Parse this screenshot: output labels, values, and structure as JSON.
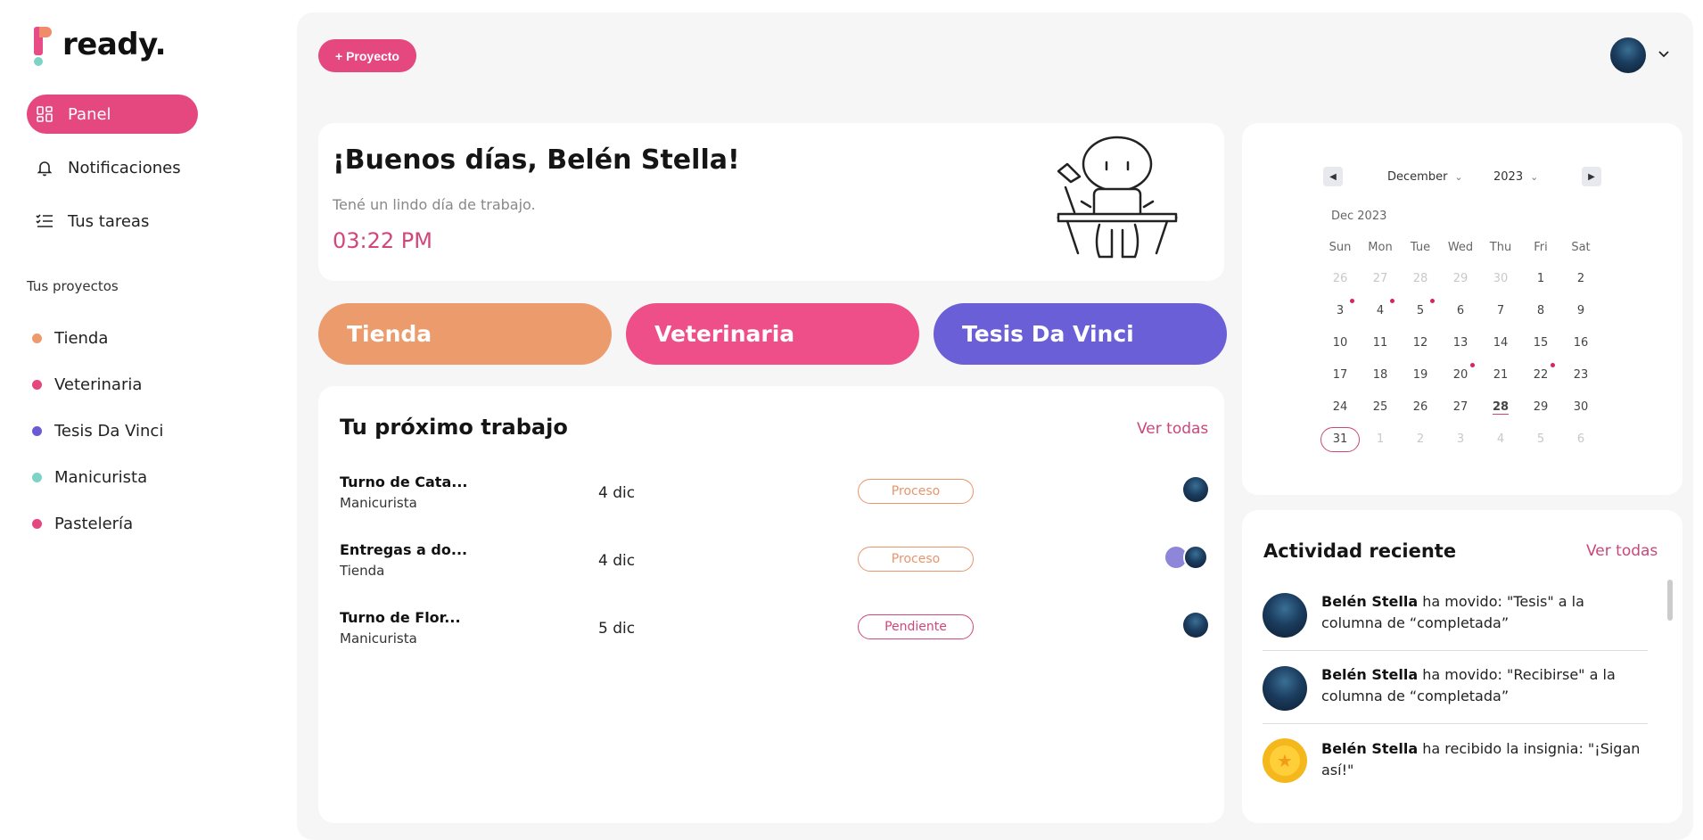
{
  "app": {
    "logo_text": "ready."
  },
  "sidebar": {
    "nav": [
      {
        "label": "Panel",
        "icon": "dashboard-icon",
        "active": true
      },
      {
        "label": "Notificaciones",
        "icon": "bell-icon",
        "active": false
      },
      {
        "label": "Tus tareas",
        "icon": "checklist-icon",
        "active": false
      }
    ],
    "projects_title": "Tus proyectos",
    "projects": [
      {
        "label": "Tienda",
        "color": "#ef9a6e"
      },
      {
        "label": "Veterinaria",
        "color": "#e5477f"
      },
      {
        "label": "Tesis Da Vinci",
        "color": "#6a5bd3"
      },
      {
        "label": "Manicurista",
        "color": "#7dd3c7"
      },
      {
        "label": "Pastelería",
        "color": "#e5477f"
      }
    ]
  },
  "header": {
    "new_project_label": "+ Proyecto",
    "user_menu_icon": "chevron-down-icon"
  },
  "greeting": {
    "title": "¡Buenos días, Belén Stella!",
    "subtitle": "Tené un lindo día de trabajo.",
    "time": "03:22 PM"
  },
  "project_pills": [
    {
      "label": "Tienda",
      "color": "#ec9b6c"
    },
    {
      "label": "Veterinaria",
      "color": "#ee4f88"
    },
    {
      "label": "Tesis Da Vinci",
      "color": "#6a5fd6"
    }
  ],
  "next_work": {
    "title": "Tu próximo trabajo",
    "see_all": "Ver todas",
    "rows": [
      {
        "name": "Turno de Cata...",
        "project": "Manicurista",
        "date": "4 dic",
        "status": "Proceso",
        "status_color": "#e8956a"
      },
      {
        "name": "Entregas a do...",
        "project": "Tienda",
        "date": "4 dic",
        "status": "Proceso",
        "status_color": "#e8956a"
      },
      {
        "name": "Turno de Flor...",
        "project": "Manicurista",
        "date": "5 dic",
        "status": "Pendiente",
        "status_color": "#d2467c"
      }
    ]
  },
  "calendar": {
    "month": "December",
    "year": "2023",
    "label": "Dec 2023",
    "weekdays": [
      "Sun",
      "Mon",
      "Tue",
      "Wed",
      "Thu",
      "Fri",
      "Sat"
    ],
    "weeks": [
      [
        "26",
        "27",
        "28",
        "29",
        "30",
        "1",
        "2"
      ],
      [
        "3",
        "4",
        "5",
        "6",
        "7",
        "8",
        "9"
      ],
      [
        "10",
        "11",
        "12",
        "13",
        "14",
        "15",
        "16"
      ],
      [
        "17",
        "18",
        "19",
        "20",
        "21",
        "22",
        "23"
      ],
      [
        "24",
        "25",
        "26",
        "27",
        "28",
        "29",
        "30"
      ],
      [
        "31",
        "1",
        "2",
        "3",
        "4",
        "5",
        "6"
      ]
    ],
    "event_days": [
      "3",
      "4",
      "5",
      "20",
      "22"
    ],
    "today": "28",
    "selected": "31"
  },
  "activity": {
    "title": "Actividad reciente",
    "see_all": "Ver todas",
    "items": [
      {
        "user": "Belén Stella",
        "text": " ha movido: \"Tesis\" a la columna de “completada”"
      },
      {
        "user": "Belén Stella",
        "text": " ha movido: \"Recibirse\" a la columna de “completada”"
      },
      {
        "user": "Belén Stella",
        "text": " ha recibido la insignia: \"¡Sigan así!\""
      }
    ]
  }
}
